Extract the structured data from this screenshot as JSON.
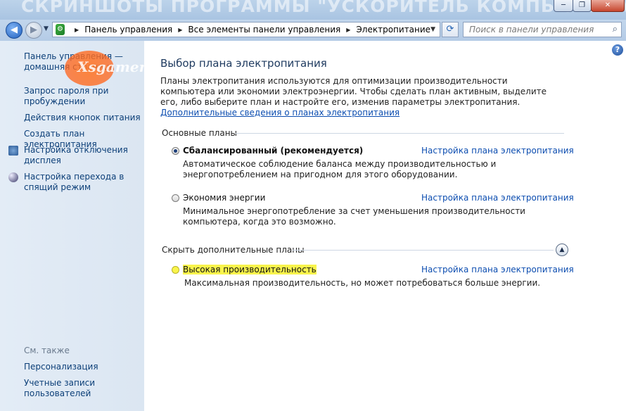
{
  "window": {
    "watermark": "СКРИНШОТЫ ПРОГРАММЫ \"УСКОРИТЕЛЬ КОМПЬЮТЕРА\"",
    "controls": [
      "─",
      "❐",
      "✕"
    ]
  },
  "logo": {
    "text": "Xsgamers"
  },
  "nav": {
    "breadcrumbs": [
      "Панель управления",
      "Все элементы панели управления",
      "Электропитание"
    ],
    "search_placeholder": "Поиск в панели управления"
  },
  "sidebar": {
    "links": [
      "Панель управления — домашняя страница",
      "Запрос пароля при пробуждении",
      "Действия кнопок питания",
      "Создать план электропитания",
      "Настройка отключения дисплея",
      "Настройка перехода в спящий режим"
    ],
    "see_also_label": "См. также",
    "see_also": [
      "Персонализация",
      "Учетные записи пользователей"
    ]
  },
  "main": {
    "title": "Выбор плана электропитания",
    "intro": "Планы электропитания используются для оптимизации производительности компьютера или экономии электроэнергии. Чтобы сделать план активным, выделите его, либо выберите план и настройте его, изменив параметры электропитания.",
    "intro_link": "Дополнительные сведения о планах электропитания",
    "basic_plans_label": "Основные планы",
    "hidden_plans_label": "Скрыть дополнительные планы",
    "plan_link_label": "Настройка плана электропитания",
    "plans": [
      {
        "name": "Сбалансированный (рекомендуется)",
        "desc": "Автоматическое соблюдение баланса между производительностью и энергопотреблением на пригодном для этого оборудовании.",
        "selected": true
      },
      {
        "name": "Экономия энергии",
        "desc": "Минимальное энергопотребление за счет уменьшения производительности компьютера, когда это возможно.",
        "selected": false
      },
      {
        "name": "Высокая производительность",
        "desc": "Максимальная производительность, но может потребоваться больше энергии.",
        "selected": false
      }
    ]
  },
  "colors": {
    "link": "#0c4db0",
    "highlight": "#f9f44c"
  }
}
